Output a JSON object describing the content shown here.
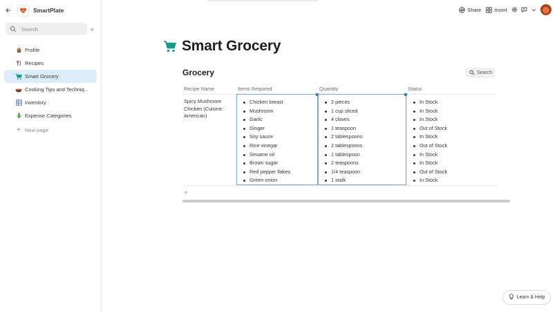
{
  "workspace": {
    "name": "SmartPlate"
  },
  "sidebar": {
    "search_placeholder": "Search",
    "items": [
      {
        "label": "Profile",
        "icon": "profile-icon"
      },
      {
        "label": "Recipes",
        "icon": "utensils-icon"
      },
      {
        "label": "Smart Grocery",
        "icon": "cart-icon"
      },
      {
        "label": "Cooking Tips and Techniq...",
        "icon": "bowl-icon"
      },
      {
        "label": "Inventory",
        "icon": "inventory-icon"
      },
      {
        "label": "Expense Categories",
        "icon": "expense-icon"
      }
    ],
    "new_page_label": "New page"
  },
  "topbar": {
    "share_label": "Share",
    "insert_label": "Insert"
  },
  "page": {
    "title": "Smart Grocery"
  },
  "database": {
    "title": "Grocery",
    "search_label": "Search",
    "columns": [
      "Recipe Name",
      "Items Required",
      "Quantity",
      "Status"
    ],
    "rows": [
      {
        "recipe": "Spicy Mushroom Chicken (Cuisine: American)",
        "items": [
          "Chicken breast",
          "Mushroom",
          "Garlic",
          "Ginger",
          "Soy sauce",
          "Rice vinegar",
          "Sesame oil",
          "Brown sugar",
          "Red pepper flakes",
          "Green onion"
        ],
        "quantities": [
          "2 pieces",
          "1 cup sliced",
          "4 cloves",
          "1 teaspoon",
          "2 tablespoons",
          "2 tablespoons",
          "1 tablespoon",
          "2 teaspoons",
          "1/4 teaspoon",
          "1 stalk"
        ],
        "statuses": [
          "In Stock",
          "In Stock",
          "In Stock",
          "Out of Stock",
          "In Stock",
          "Out of Stock",
          "In Stock",
          "In Stock",
          "Out of Stock",
          "In Stock"
        ]
      }
    ]
  },
  "help": {
    "label": "Learn & Help"
  },
  "colors": {
    "active_nav": "#dcecf8",
    "selection": "#7aa7d9",
    "accent": "#2e7bd6",
    "cart": "#0f9d8a"
  }
}
